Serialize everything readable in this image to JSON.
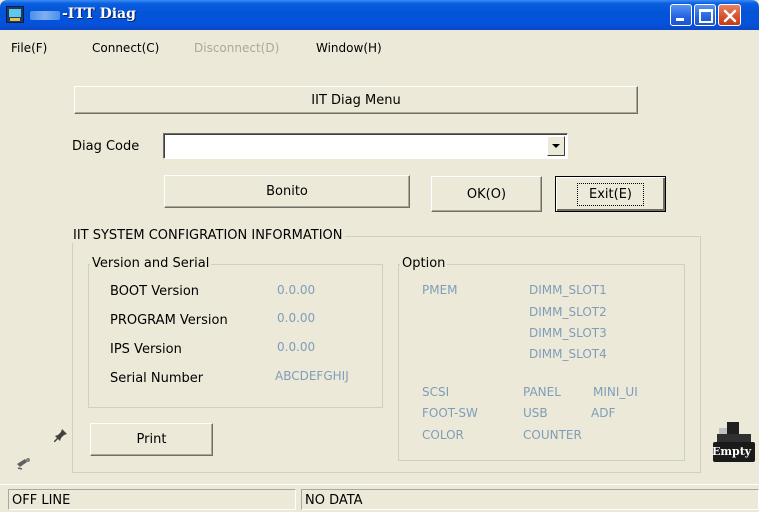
{
  "window": {
    "title": "-ITT Diag",
    "controls": {
      "minimize": "minimize-icon",
      "maximize": "maximize-icon",
      "close": "close-icon"
    }
  },
  "menu": {
    "file": "File(F)",
    "connect": "Connect(C)",
    "disconnect": "Disconnect(D)",
    "window": "Window(H)"
  },
  "main": {
    "menu_header": "IIT Diag Menu",
    "diag_code_label": "Diag Code",
    "diag_code_value": "",
    "model_button": "Bonito",
    "ok_button": "OK(O)",
    "exit_button": "Exit(E)",
    "print_button": "Print"
  },
  "system_info": {
    "title": "IIT SYSTEM CONFIGRATION INFORMATION",
    "version": {
      "title": "Version and Serial",
      "boot_label": "BOOT Version",
      "boot_value": "0.0.00",
      "program_label": "PROGRAM Version",
      "program_value": "0.0.00",
      "ips_label": "IPS Version",
      "ips_value": "0.0.00",
      "serial_label": "Serial Number",
      "serial_value": "ABCDEFGHIJ"
    },
    "option": {
      "title": "Option",
      "pmem": "PMEM",
      "dimm_slots": [
        "DIMM_SLOT1",
        "DIMM_SLOT2",
        "DIMM_SLOT3",
        "DIMM_SLOT4"
      ],
      "scsi": "SCSI",
      "panel": "PANEL",
      "mini_ui": "MINI_UI",
      "foot_sw": "FOOT-SW",
      "usb": "USB",
      "adf": "ADF",
      "color": "COLOR",
      "counter": "COUNTER"
    }
  },
  "printer_status": "Empty",
  "status": {
    "connection": "OFF LINE",
    "data": "NO DATA"
  },
  "colors": {
    "titlebar": "#0454d6",
    "window_bg": "#ece9d8",
    "option_text": "#7f9db9",
    "close_button": "#d4502d"
  }
}
